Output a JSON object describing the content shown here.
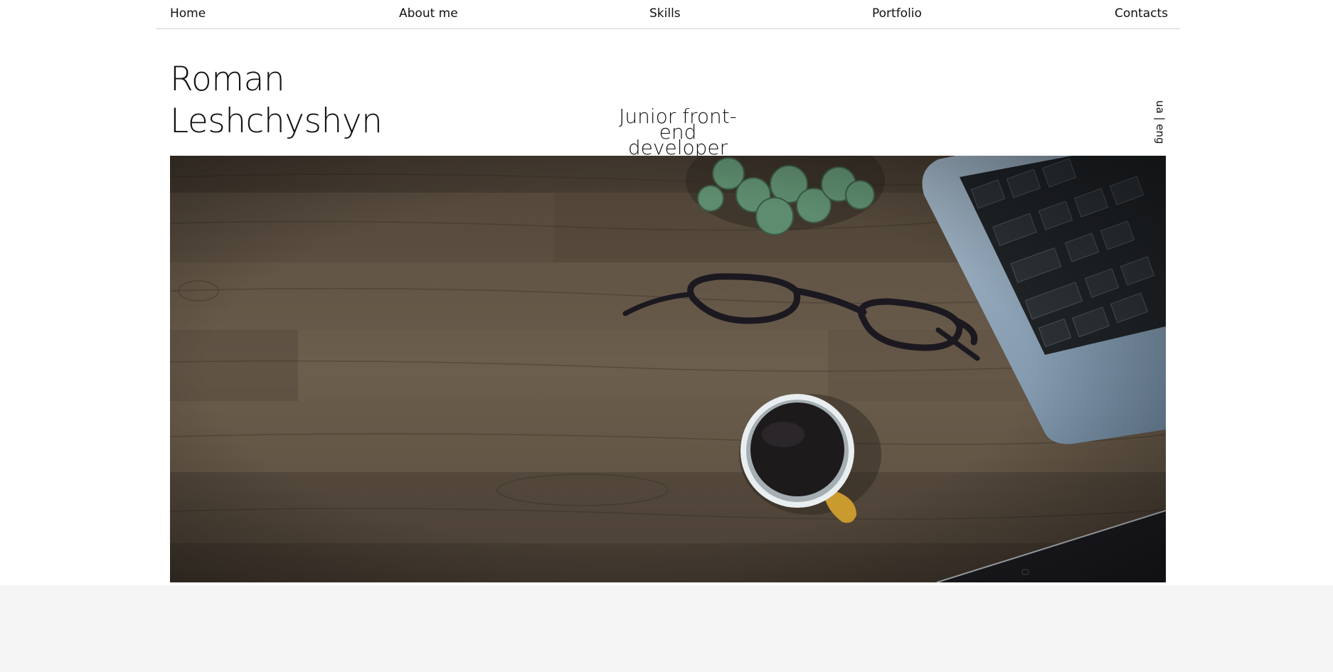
{
  "nav": {
    "home": "Home",
    "about": "About me",
    "skills": "Skills",
    "portfolio": "Portfolio",
    "contacts": "Contacts"
  },
  "header": {
    "name_first": "Roman",
    "name_last": "Leshchyshyn",
    "role_line1": "Junior front-end",
    "role_line2": "developer",
    "language_switch": "ua | eng"
  },
  "hero": {
    "image_alt": "Top-down view of a wooden desk with a laptop, glasses, a succulent plant and a cup of coffee",
    "colors": {
      "wood": "#5a4d3f",
      "laptop": "#8fa3b5",
      "coffee": "#1d1a1c",
      "plant": "#5e8c6e"
    }
  }
}
